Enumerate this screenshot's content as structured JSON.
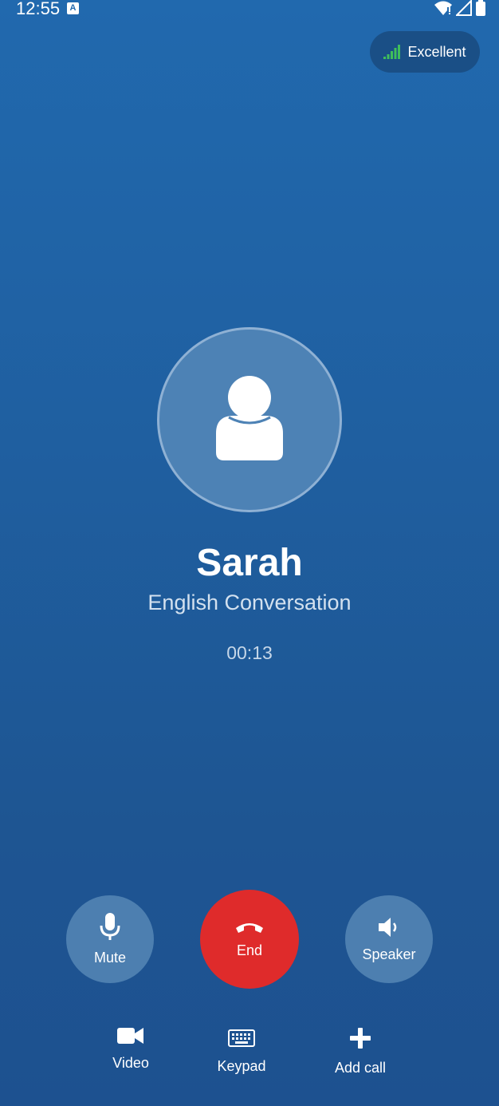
{
  "status_bar": {
    "time": "12:55",
    "notification_icon": "a-icon",
    "wifi_icon": "wifi-icon",
    "signal_icon": "cell-signal-icon",
    "battery_icon": "battery-icon"
  },
  "connection": {
    "label": "Excellent",
    "icon": "signal-bars-icon",
    "accent": "#3fbf5a"
  },
  "caller": {
    "name": "Sarah",
    "subtitle": "English Conversation",
    "duration": "00:13",
    "avatar_icon": "person-icon"
  },
  "controls": {
    "mute_label": "Mute",
    "end_label": "End",
    "speaker_label": "Speaker",
    "end_color": "#df2b2b"
  },
  "actions": {
    "video_label": "Video",
    "keypad_label": "Keypad",
    "add_call_label": "Add call"
  }
}
